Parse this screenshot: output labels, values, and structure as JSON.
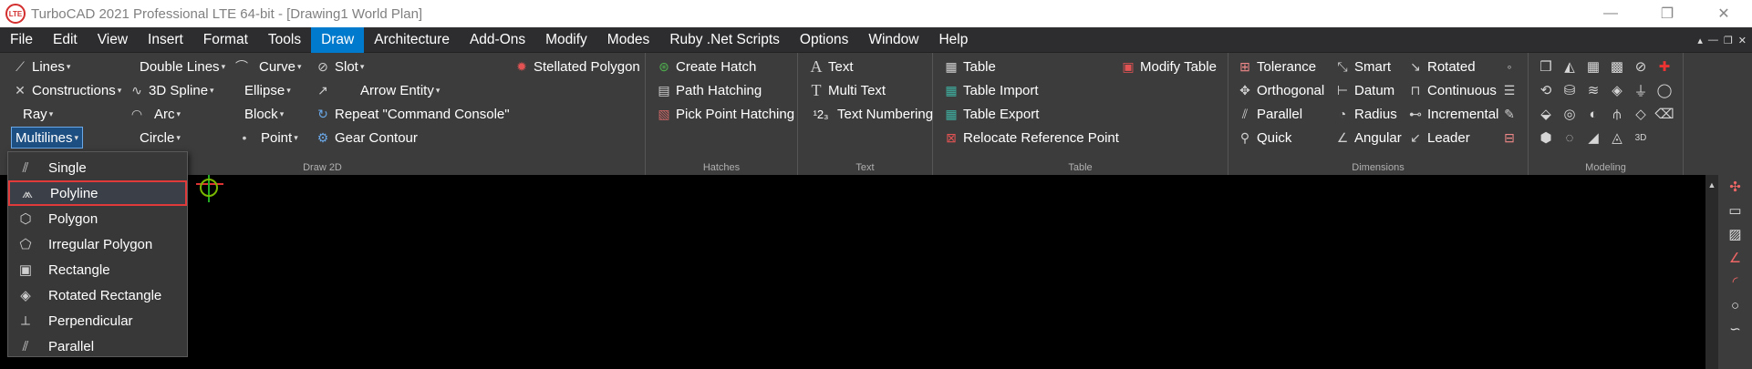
{
  "titlebar": {
    "logo": "LTE",
    "title": "TurboCAD 2021 Professional LTE 64-bit - [Drawing1 World Plan]",
    "minimize": "—",
    "maximize": "❐",
    "close": "✕"
  },
  "menubar": {
    "items": [
      "File",
      "Edit",
      "View",
      "Insert",
      "Format",
      "Tools",
      "Draw",
      "Architecture",
      "Add-Ons",
      "Modify",
      "Modes",
      "Ruby .Net Scripts",
      "Options",
      "Window",
      "Help"
    ],
    "active": "Draw",
    "mdi_controls": [
      "▴",
      "—",
      "❐",
      "✕"
    ]
  },
  "ribbon": {
    "draw2d": {
      "label": "Draw 2D",
      "lines": "Lines",
      "constructions": "Constructions",
      "ray": "Ray",
      "multilines": "Multilines",
      "double_lines": "Double Lines",
      "spline3d": "3D Spline",
      "arc": "Arc",
      "circle": "Circle",
      "curve": "Curve",
      "ellipse": "Ellipse",
      "block": "Block",
      "point": "Point",
      "slot": "Slot",
      "arrow_entity": "Arrow Entity",
      "repeat": "Repeat \"Command Console\"",
      "gear_contour": "Gear Contour",
      "stellated_polygon": "Stellated Polygon"
    },
    "hatches": {
      "label": "Hatches",
      "create_hatch": "Create Hatch",
      "path_hatching": "Path Hatching",
      "pick_point_hatching": "Pick Point Hatching"
    },
    "text": {
      "label": "Text",
      "text": "Text",
      "multi_text": "Multi Text",
      "text_numbering": "Text Numbering",
      "numbering_icon": "¹2₃"
    },
    "table": {
      "label": "Table",
      "table": "Table",
      "table_import": "Table Import",
      "table_export": "Table Export",
      "relocate_reference_point": "Relocate Reference Point",
      "modify_table": "Modify Table"
    },
    "dimensions": {
      "label": "Dimensions",
      "tolerance": "Tolerance",
      "orthogonal": "Orthogonal",
      "parallel": "Parallel",
      "quick": "Quick",
      "smart": "Smart",
      "datum": "Datum",
      "radius": "Radius",
      "angular": "Angular",
      "rotated": "Rotated",
      "continuous": "Continuous",
      "incremental": "Incremental",
      "leader": "Leader"
    },
    "modeling": {
      "label": "Modeling"
    }
  },
  "multilines_menu": {
    "items": [
      "Single",
      "Polyline",
      "Polygon",
      "Irregular Polygon",
      "Rectangle",
      "Rotated Rectangle",
      "Perpendicular",
      "Parallel"
    ],
    "highlighted": "Polyline"
  },
  "colors": {
    "accent": "#007acc",
    "ribbon_bg": "#3c3c3c",
    "highlight_border": "#e03a3a"
  }
}
